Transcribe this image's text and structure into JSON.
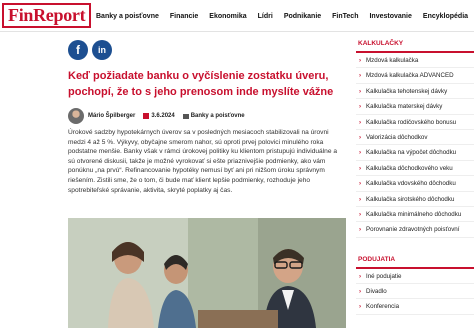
{
  "logo": "FinReport",
  "nav": [
    "Banky a poisťovne",
    "Financie",
    "Ekonomika",
    "Lídri",
    "Podnikanie",
    "FinTech",
    "Investovanie",
    "Encyklopédia"
  ],
  "social": {
    "facebook": "f",
    "linkedin": "in"
  },
  "article": {
    "title": "Keď požiadate banku o vyčíslenie zostatku úveru, pochopí, že to s jeho prenosom inde myslíte vážne",
    "author": "Mário Špilberger",
    "date": "3.6.2024",
    "category": "Banky a poisťovne",
    "body": "Úrokové sadzby hypotekárnych úverov sa v posledných mesiacoch stabilizovali na úrovni medzi 4 až 5 %. Výkyvy, obyčajne smerom nahor, sú oproti prvej polovici minulého roka podstatne menšie. Banky však v rámci úrokovej politiky ku klientom pristupujú individuálne a sú otvorené diskusii, takže je možné vyrokovať si ešte priaznivejšie podmienky, ako vám ponúknu „na prvú“. Refinancovanie hypotéky nemusí byť ani pri nižšom úroku správnym riešením. Zistili sme, že o tom, či bude mať klient lepšie podmienky, rozhoduje jeho spotrebiteľské správanie, aktivita, skryté poplatky aj čas."
  },
  "sidebar": {
    "calc_title": "KALKULAČKY",
    "calc_items": [
      "Mzdová kalkulačka",
      "Mzdová kalkulačka ADVANCED",
      "Kalkulačka tehotenskej dávky",
      "Kalkulačka materskej dávky",
      "Kalkulačka rodičovského bonusu",
      "Valorizácia dôchodkov",
      "Kalkulačka na výpočet dôchodku",
      "Kalkulačka dôchodkového veku",
      "Kalkulačka vdovského dôchodku",
      "Kalkulačka sirotského dôchodku",
      "Kalkulačka minimálneho dôchodku",
      "Porovnanie zdravotných poisťovní"
    ],
    "podujatia_title": "PODUJATIA",
    "podujatia_items": [
      "Iné podujatie",
      "Divadlo",
      "Konferencia"
    ]
  }
}
